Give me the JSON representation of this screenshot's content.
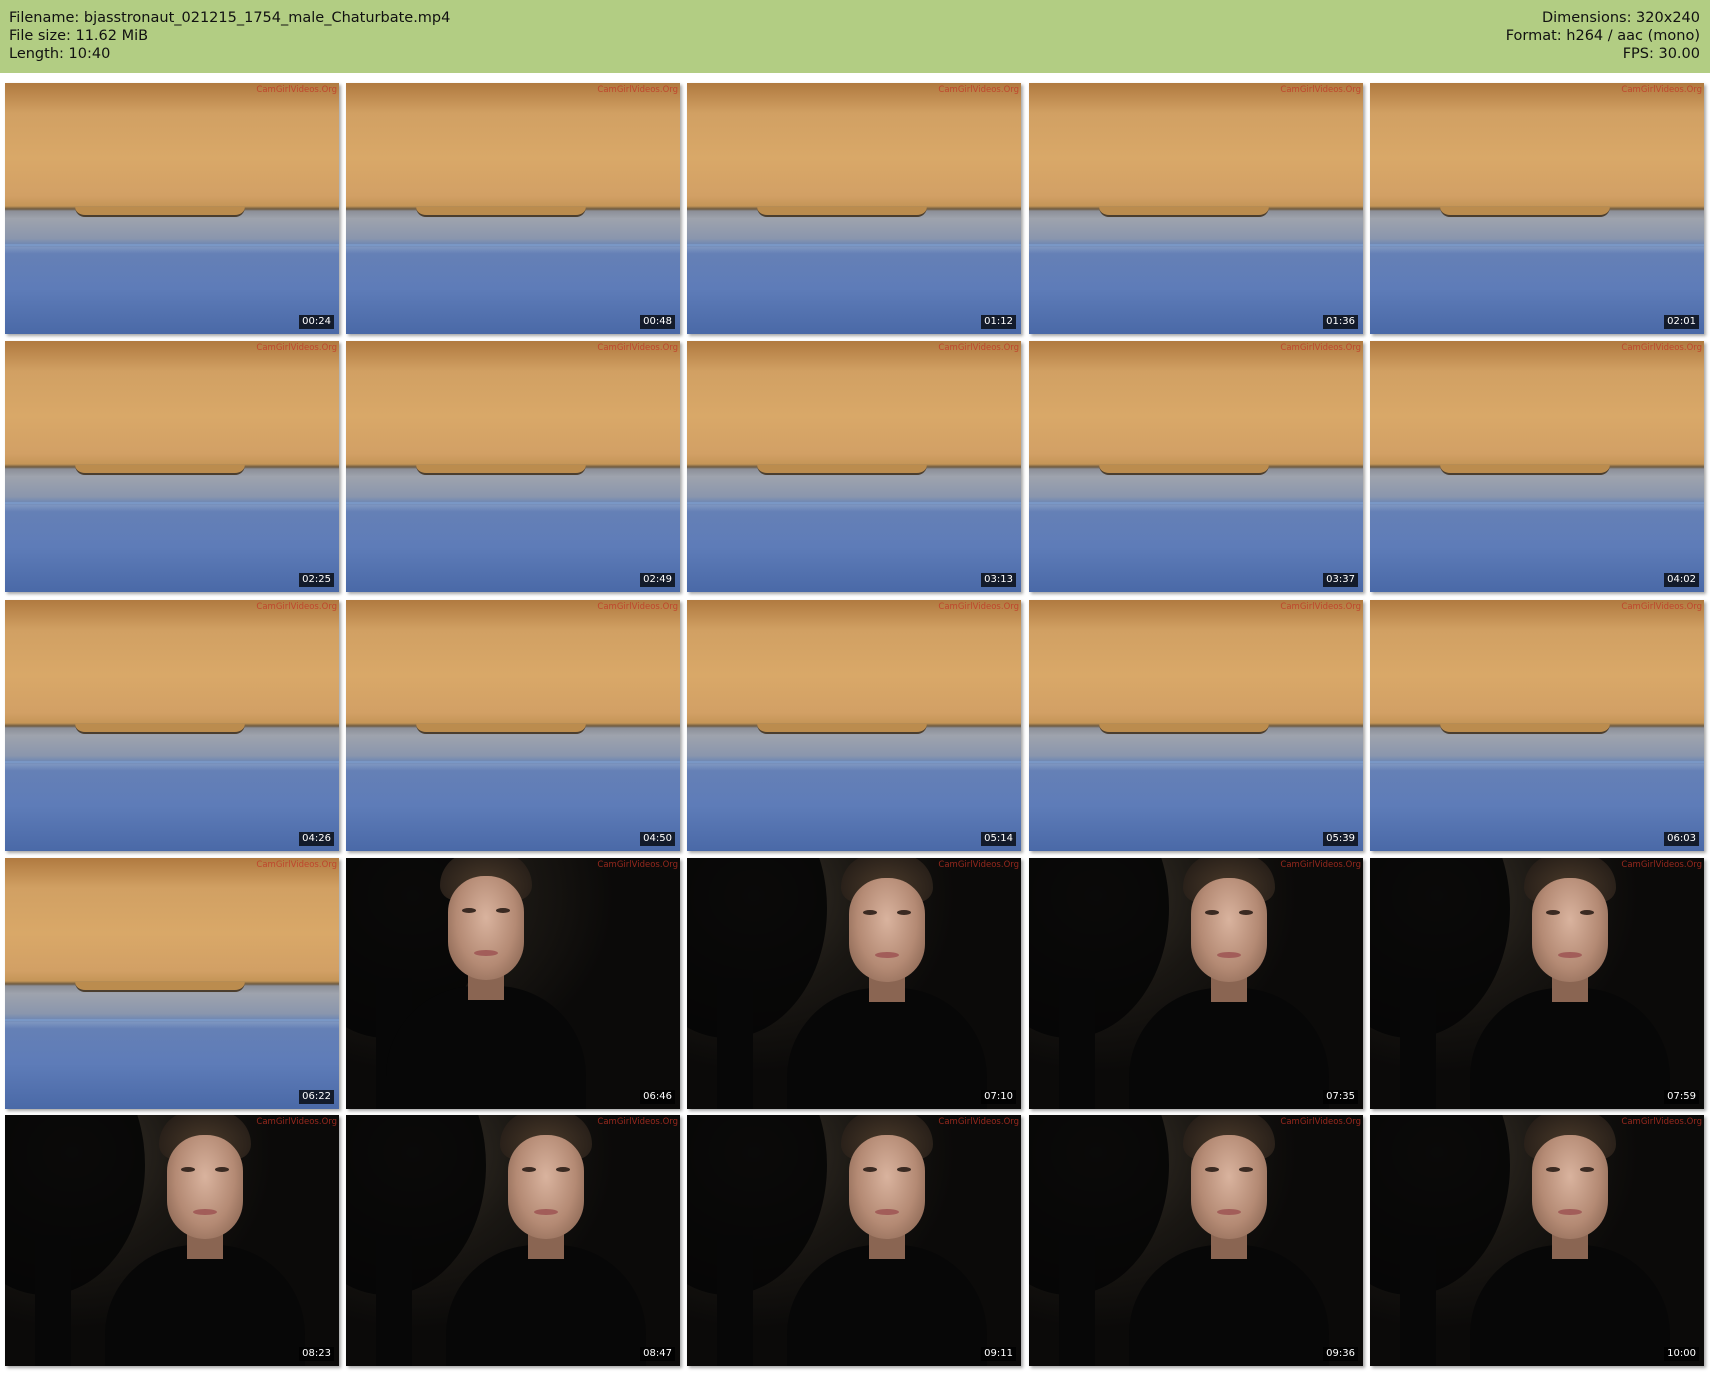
{
  "header": {
    "filename": "Filename: bjasstronaut_021215_1754_male_Chaturbate.mp4",
    "filesize": "File size: 11.62 MiB",
    "length": "Length: 10:40",
    "dimensions": "Dimensions: 320x240",
    "format": "Format: h264 / aac (mono)",
    "fps": "FPS: 30.00"
  },
  "watermark": "CamGirlVideos.Org",
  "thumbnails": [
    {
      "time": "00:24",
      "scene": "desk"
    },
    {
      "time": "00:48",
      "scene": "desk"
    },
    {
      "time": "01:12",
      "scene": "desk"
    },
    {
      "time": "01:36",
      "scene": "desk"
    },
    {
      "time": "02:01",
      "scene": "desk"
    },
    {
      "time": "02:25",
      "scene": "desk"
    },
    {
      "time": "02:49",
      "scene": "desk"
    },
    {
      "time": "03:13",
      "scene": "desk"
    },
    {
      "time": "03:37",
      "scene": "desk"
    },
    {
      "time": "04:02",
      "scene": "desk"
    },
    {
      "time": "04:26",
      "scene": "desk"
    },
    {
      "time": "04:50",
      "scene": "desk"
    },
    {
      "time": "05:14",
      "scene": "desk"
    },
    {
      "time": "05:39",
      "scene": "desk"
    },
    {
      "time": "06:03",
      "scene": "desk"
    },
    {
      "time": "06:22",
      "scene": "desk"
    },
    {
      "time": "06:46",
      "scene": "person"
    },
    {
      "time": "07:10",
      "scene": "person"
    },
    {
      "time": "07:35",
      "scene": "person"
    },
    {
      "time": "07:59",
      "scene": "person"
    },
    {
      "time": "08:23",
      "scene": "person"
    },
    {
      "time": "08:47",
      "scene": "person"
    },
    {
      "time": "09:11",
      "scene": "person"
    },
    {
      "time": "09:36",
      "scene": "person"
    },
    {
      "time": "10:00",
      "scene": "person"
    }
  ]
}
